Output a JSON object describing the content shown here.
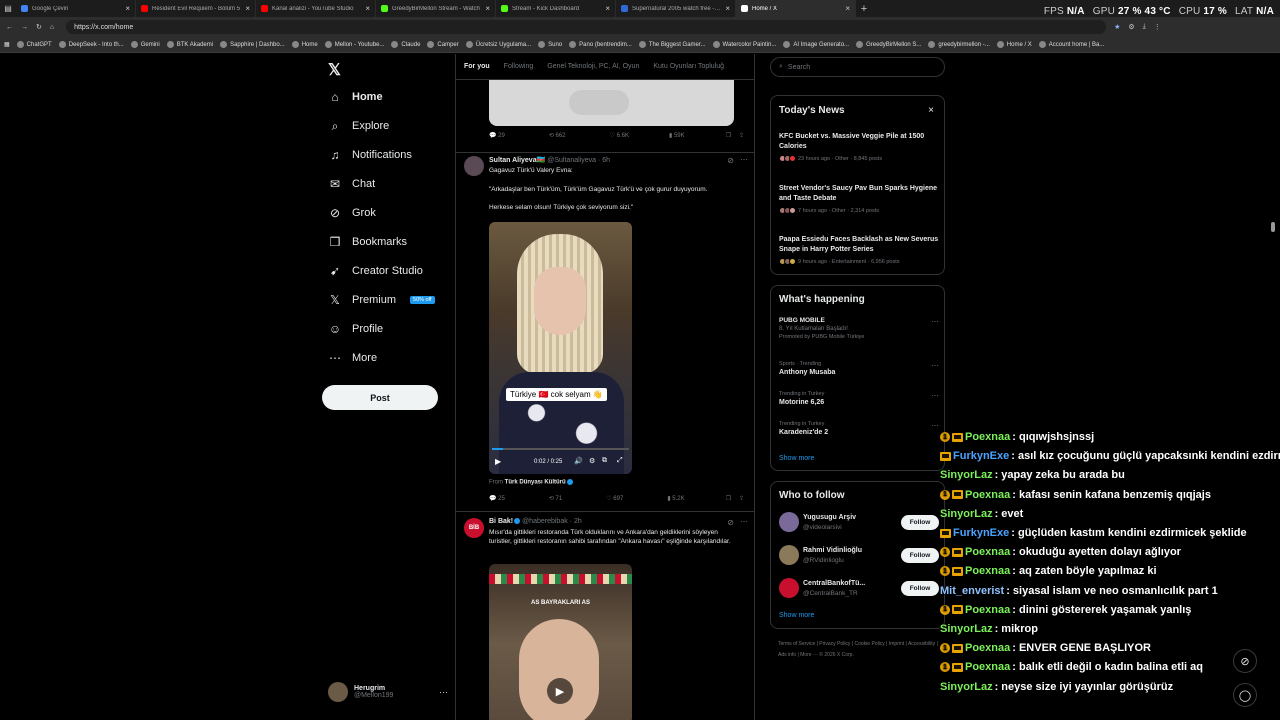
{
  "browser": {
    "tabs": [
      {
        "title": "Google Çeviri",
        "color": "#4285f4",
        "active": false
      },
      {
        "title": "Resident Evil Requiem - Bölüm 5",
        "color": "#ff0000",
        "active": false
      },
      {
        "title": "Kanal analizi - YouTube Studio",
        "color": "#ff0000",
        "active": false
      },
      {
        "title": "GreedyBirMellon Stream - Watch",
        "color": "#53fc18",
        "active": false
      },
      {
        "title": "Stream - Kick Dashboard",
        "color": "#53fc18",
        "active": false
      },
      {
        "title": "Supernatural 2005 watch free - 11",
        "color": "#2f6bd8",
        "active": false
      },
      {
        "title": "Home / X",
        "color": "#ffffff",
        "active": true
      }
    ],
    "url": "https://x.com/home",
    "perf": {
      "fps_label": "FPS",
      "fps": "N/A",
      "gpu_label": "GPU",
      "gpu": "27 % 43 °C",
      "cpu_label": "CPU",
      "cpu": "17 %",
      "lat_label": "LAT",
      "lat": "N/A"
    },
    "bookmarks": [
      "ChatGPT",
      "DeepSeek - Into th...",
      "Gemini",
      "BTK Akademi",
      "Sapphire | Dashbo...",
      "Home",
      "Mellon - Youtube...",
      "Claude",
      "Camper",
      "Ücretsiz Uygulama...",
      "Suno",
      "Pano (bentrendim...",
      "The Biggest Gamer...",
      "Watercolor Paintin...",
      "AI Image Generato...",
      "GreedyBirMellon S...",
      "greedybirmellon -...",
      "Home / X",
      "Account home | Ba..."
    ]
  },
  "nav": {
    "items": [
      {
        "label": "Home",
        "icon": "home-icon",
        "glyph": "⌂"
      },
      {
        "label": "Explore",
        "icon": "search-icon",
        "glyph": "⌕"
      },
      {
        "label": "Notifications",
        "icon": "bell-icon",
        "glyph": "♫"
      },
      {
        "label": "Chat",
        "icon": "mail-icon",
        "glyph": "✉"
      },
      {
        "label": "Grok",
        "icon": "grok-icon",
        "glyph": "⊘"
      },
      {
        "label": "Bookmarks",
        "icon": "bookmark-icon",
        "glyph": "❒"
      },
      {
        "label": "Creator Studio",
        "icon": "rocket-icon",
        "glyph": "➹"
      },
      {
        "label": "Premium",
        "icon": "x-logo-icon",
        "glyph": "𝕏"
      },
      {
        "label": "Profile",
        "icon": "person-icon",
        "glyph": "☺"
      },
      {
        "label": "More",
        "icon": "more-icon",
        "glyph": "⋯"
      }
    ],
    "premium_badge": "50% off",
    "post_label": "Post",
    "profile_name": "Herugrim",
    "profile_handle": "@Mellon199"
  },
  "timeline": {
    "tabs": [
      "For you",
      "Following",
      "Genel Teknoloji, PC, AI, Oyun",
      "Kutu Oyunları Topluluğ"
    ],
    "tweet0_stats": {
      "replies": "29",
      "reposts": "662",
      "likes": "6.6K",
      "views": "59K"
    },
    "tweet1": {
      "name": "Sultan Aliyeva🇦🇿",
      "handle": "@Sultanaliyeva",
      "time": "· 6h",
      "text1": "Gagavuz Türk'ü Valery Evna:",
      "text2": "\"Arkadaşlar ben Türk'üm, Türk'üm Gagavuz Türk'ü ve çok gurur duyuyorum.",
      "text3": "Herkese selam olsun! Türkiye çok seviyorum sizi.\"",
      "caption": "Türkiye 🇹🇷 cok selyam 👋",
      "video_time": "0:02 / 0:25",
      "from_label": "From",
      "from_source": "Türk Dünyası Kültürü",
      "stats": {
        "replies": "25",
        "reposts": "71",
        "likes": "697",
        "views": "5.2K"
      }
    },
    "tweet2": {
      "name": "Bi Bak!",
      "handle": "@haberebibak",
      "time": "· 2h",
      "text": "Mısır'da gittikleri restoranda Türk olduklarını ve Ankara'dan geldiklerini söyleyen turistler, gittikleri restoranın sahibi tarafından \"Ankara havası\" eşliğinde karşılandılar.",
      "image_caption": "AS BAYRAKLARI AS"
    }
  },
  "sidebar": {
    "search_placeholder": "Search",
    "todays_news": {
      "title": "Today's News",
      "items": [
        {
          "title": "KFC Bucket vs. Massive Veggie Pile at 1500 Calories",
          "meta": "23 hours ago · Other · 8,845 posts"
        },
        {
          "title": "Street Vendor's Saucy Pav Bun Sparks Hygiene and Taste Debate",
          "meta": "7 hours ago · Other · 2,314 posts"
        },
        {
          "title": "Paapa Essiedu Faces Backlash as New Severus Snape in Harry Potter Series",
          "meta": "9 hours ago · Entertainment · 6,956 posts"
        }
      ]
    },
    "whats_happening": {
      "title": "What's happening",
      "items": [
        {
          "category": "PUBG MOBILE",
          "name": "8. Yıl Kutlamaları Başladı!",
          "promo": "Promoted by PUBG Mobile Türkiye"
        },
        {
          "category": "Sports · Trending",
          "name": "Anthony Musaba"
        },
        {
          "category": "Trending in Turkey",
          "name": "Motorine 6,26"
        },
        {
          "category": "Trending in Turkey",
          "name": "Karadeniz'de 2"
        }
      ],
      "show_more": "Show more"
    },
    "who_to_follow": {
      "title": "Who to follow",
      "items": [
        {
          "name": "Yugusugu Arşiv",
          "handle": "@videolarsivi",
          "color": "#7a6a9a"
        },
        {
          "name": "Rahmi Vidinlioğlu",
          "handle": "@RVidinlioglu",
          "color": "#8a7a5a"
        },
        {
          "name": "CentralBankofTü...",
          "handle": "@CentralBank_TR",
          "color": "#c8102e"
        }
      ],
      "follow_label": "Follow",
      "show_more": "Show more"
    },
    "footer": "Terms of Service | Privacy Policy | Cookie Policy | Imprint | Accessibility | Ads info | More ··· © 2026 X Corp."
  },
  "chat_overlay": [
    {
      "user": "Poexnaa",
      "text": " : qıqıwjshsjnssj",
      "badges": 2,
      "color": "#7cf05a"
    },
    {
      "user": "FurkynExe",
      "text": " : asıl kız çocuğunu güçlü yapcaksınki kendini ezdirmesin",
      "badges": 1,
      "color": "#4aa3ff"
    },
    {
      "user": "SinyorLaz",
      "text": " : yapay zeka bu arada bu",
      "badges": 0,
      "color": "#7cf05a"
    },
    {
      "user": "Poexnaa",
      "text": " : kafası senin kafana benzemiş qıqjajs",
      "badges": 2,
      "color": "#7cf05a"
    },
    {
      "user": "SinyorLaz",
      "text": " : evet",
      "badges": 0,
      "color": "#7cf05a"
    },
    {
      "user": "FurkynExe",
      "text": " : güçlüden kastım kendini ezdirmicek şeklide",
      "badges": 1,
      "color": "#4aa3ff"
    },
    {
      "user": "Poexnaa",
      "text": " : okuduğu ayetten dolayı ağlıyor",
      "badges": 2,
      "color": "#7cf05a"
    },
    {
      "user": "Poexnaa",
      "text": " : aq zaten böyle yapılmaz ki",
      "badges": 2,
      "color": "#7cf05a"
    },
    {
      "user": "Mit_enverist",
      "text": " : siyasal islam ve neo osmanlıcılık part 1",
      "badges": 0,
      "color": "#8fc3ff"
    },
    {
      "user": "Poexnaa",
      "text": " : dinini göstererek yaşamak yanlış",
      "badges": 2,
      "color": "#7cf05a"
    },
    {
      "user": "SinyorLaz",
      "text": " : mikrop",
      "badges": 0,
      "color": "#7cf05a"
    },
    {
      "user": "Poexnaa",
      "text": " : ENVER GENE BAŞLIYOR",
      "badges": 2,
      "color": "#7cf05a"
    },
    {
      "user": "Poexnaa",
      "text": " : balık etli değil o kadın balina etli aq",
      "badges": 2,
      "color": "#7cf05a"
    },
    {
      "user": "SinyorLaz",
      "text": " : neyse size iyi yayınlar görüşürüz",
      "badges": 0,
      "color": "#7cf05a"
    }
  ]
}
